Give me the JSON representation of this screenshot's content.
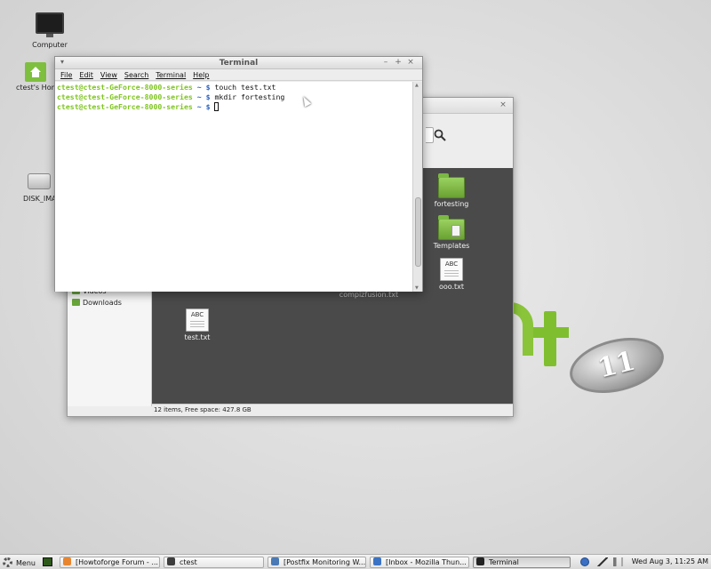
{
  "desktop": {
    "icons": [
      {
        "label": "Computer"
      },
      {
        "label": "ctest's Home"
      },
      {
        "label": "DISK_IMAGE"
      }
    ]
  },
  "logo": {
    "badge": "11"
  },
  "file_manager": {
    "close_glyph": "×",
    "sidebar": {
      "items": [
        {
          "label": "Videos"
        },
        {
          "label": "Downloads"
        }
      ]
    },
    "files": [
      {
        "label": "fortesting",
        "icon": "folder-icon"
      },
      {
        "label": "Templates",
        "icon": "folder-templates-icon"
      },
      {
        "label": "ooo.txt",
        "icon": "text-file-icon",
        "badge": "ABC"
      },
      {
        "label": "compizfusion.txt",
        "icon": "text-file-icon"
      },
      {
        "label": "test.txt",
        "icon": "text-file-icon",
        "badge": "ABC"
      }
    ],
    "status": "12 items, Free space: 427.8 GB"
  },
  "terminal": {
    "title": "Terminal",
    "window_menu_glyph": "▾",
    "controls": {
      "minimize": "–",
      "maximize": "+",
      "close": "×"
    },
    "menu": [
      "File",
      "Edit",
      "View",
      "Search",
      "Terminal",
      "Help"
    ],
    "prompt": "ctest@ctest-GeForce-8000-series",
    "prompt_sep": " ~ $",
    "commands": [
      "touch test.txt",
      "mkdir fortesting"
    ],
    "scroll_up": "▲",
    "scroll_down": "▼"
  },
  "taskbar": {
    "menu_label": "Menu",
    "tasks": [
      {
        "label": "[Howtoforge Forum - ...",
        "icon_color": "#e8852e",
        "active": false
      },
      {
        "label": "ctest",
        "icon_color": "#3c3c3c",
        "active": false
      },
      {
        "label": "[Postfix Monitoring W...",
        "icon_color": "#4a79b5",
        "active": false
      },
      {
        "label": "[Inbox - Mozilla Thun...",
        "icon_color": "#3a73c4",
        "active": false
      },
      {
        "label": "Terminal",
        "icon_color": "#222222",
        "active": true
      }
    ],
    "clock": "Wed Aug  3, 11:25 AM"
  },
  "colors": {
    "mint_green": "#8ac43a",
    "prompt_green": "#7ec51e",
    "prompt_blue": "#2a62c0",
    "fm_content_bg": "#4a4a4a"
  }
}
